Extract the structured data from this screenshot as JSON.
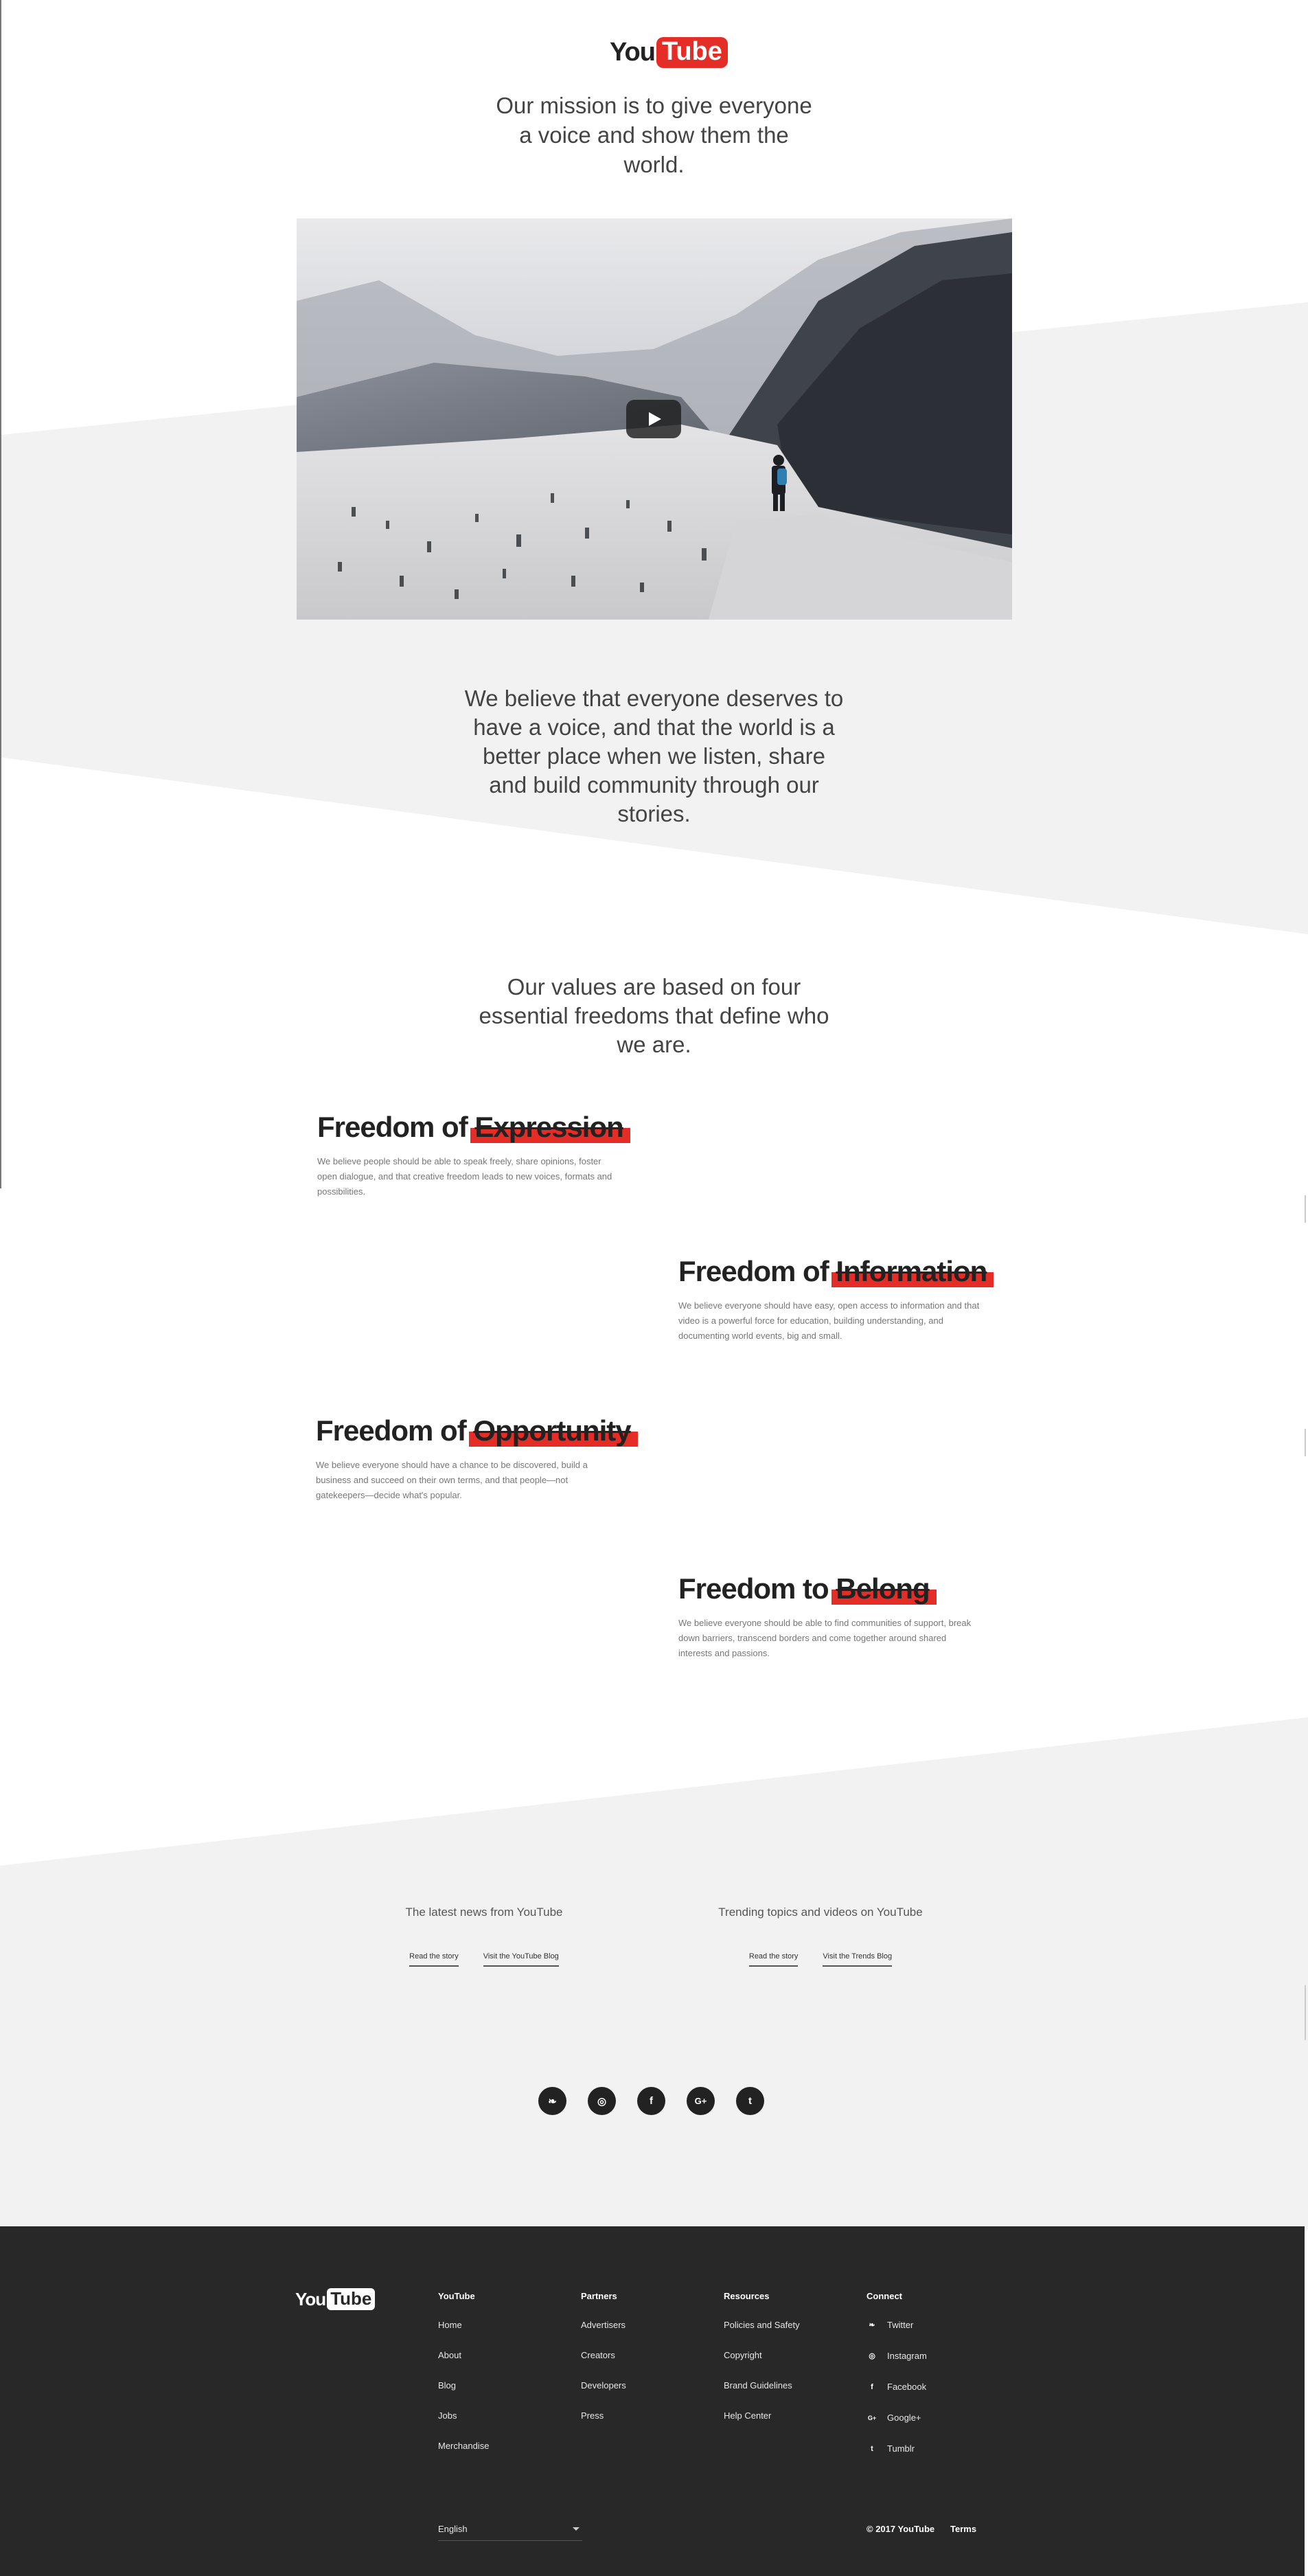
{
  "header": {
    "logo_you": "You",
    "logo_tube": "Tube",
    "mission": "Our mission is to give everyone a voice and show them the world."
  },
  "video": {
    "play_label": "Play"
  },
  "belief": "We believe that everyone deserves to have a voice, and that the world is a better place when we listen, share and build community through our stories.",
  "values_intro": "Our values are based on four essential freedoms that define who we are.",
  "freedoms": [
    {
      "prefix": "Freedom of",
      "keyword": "Expression",
      "text": "We believe people should be able to speak freely, share opinions, foster open dialogue, and that creative freedom leads to new voices, formats and possibilities."
    },
    {
      "prefix": "Freedom of",
      "keyword": "Information",
      "text": "We believe everyone should have easy, open access to information and that video is a powerful force for education, building understanding, and documenting world events, big and small."
    },
    {
      "prefix": "Freedom of",
      "keyword": "Opportunity",
      "text": "We believe everyone should have a chance to be discovered, build a business and succeed on their own terms, and that people—not gatekeepers—decide what's popular."
    },
    {
      "prefix": "Freedom to",
      "keyword": "Belong",
      "text": "We believe everyone should be able to find communities of support, break down barriers, transcend borders and come together around shared interests and passions."
    }
  ],
  "news": [
    {
      "title": "The latest news from YouTube",
      "link1": "Read the story",
      "link2": "Visit the YouTube Blog"
    },
    {
      "title": "Trending topics and videos on YouTube",
      "link1": "Read the story",
      "link2": "Visit the Trends Blog"
    }
  ],
  "social": [
    {
      "icon": "twitter-icon",
      "glyph": "❧"
    },
    {
      "icon": "instagram-icon",
      "glyph": "◎"
    },
    {
      "icon": "facebook-icon",
      "glyph": "f"
    },
    {
      "icon": "googleplus-icon",
      "glyph": "G+"
    },
    {
      "icon": "tumblr-icon",
      "glyph": "t"
    }
  ],
  "footer": {
    "logo_you": "You",
    "logo_tube": "Tube",
    "columns": [
      {
        "head": "YouTube",
        "items": [
          "Home",
          "About",
          "Blog",
          "Jobs",
          "Merchandise"
        ]
      },
      {
        "head": "Partners",
        "items": [
          "Advertisers",
          "Creators",
          "Developers",
          "Press"
        ]
      },
      {
        "head": "Resources",
        "items": [
          "Policies and Safety",
          "Copyright",
          "Brand Guidelines",
          "Help Center"
        ]
      },
      {
        "head": "Connect",
        "items": [
          "Twitter",
          "Instagram",
          "Facebook",
          "Google+",
          "Tumblr"
        ]
      }
    ],
    "connect_icons": [
      "❧",
      "◎",
      "f",
      "G+",
      "t"
    ],
    "language": "English",
    "copyright": "© 2017 YouTube",
    "terms": "Terms"
  }
}
